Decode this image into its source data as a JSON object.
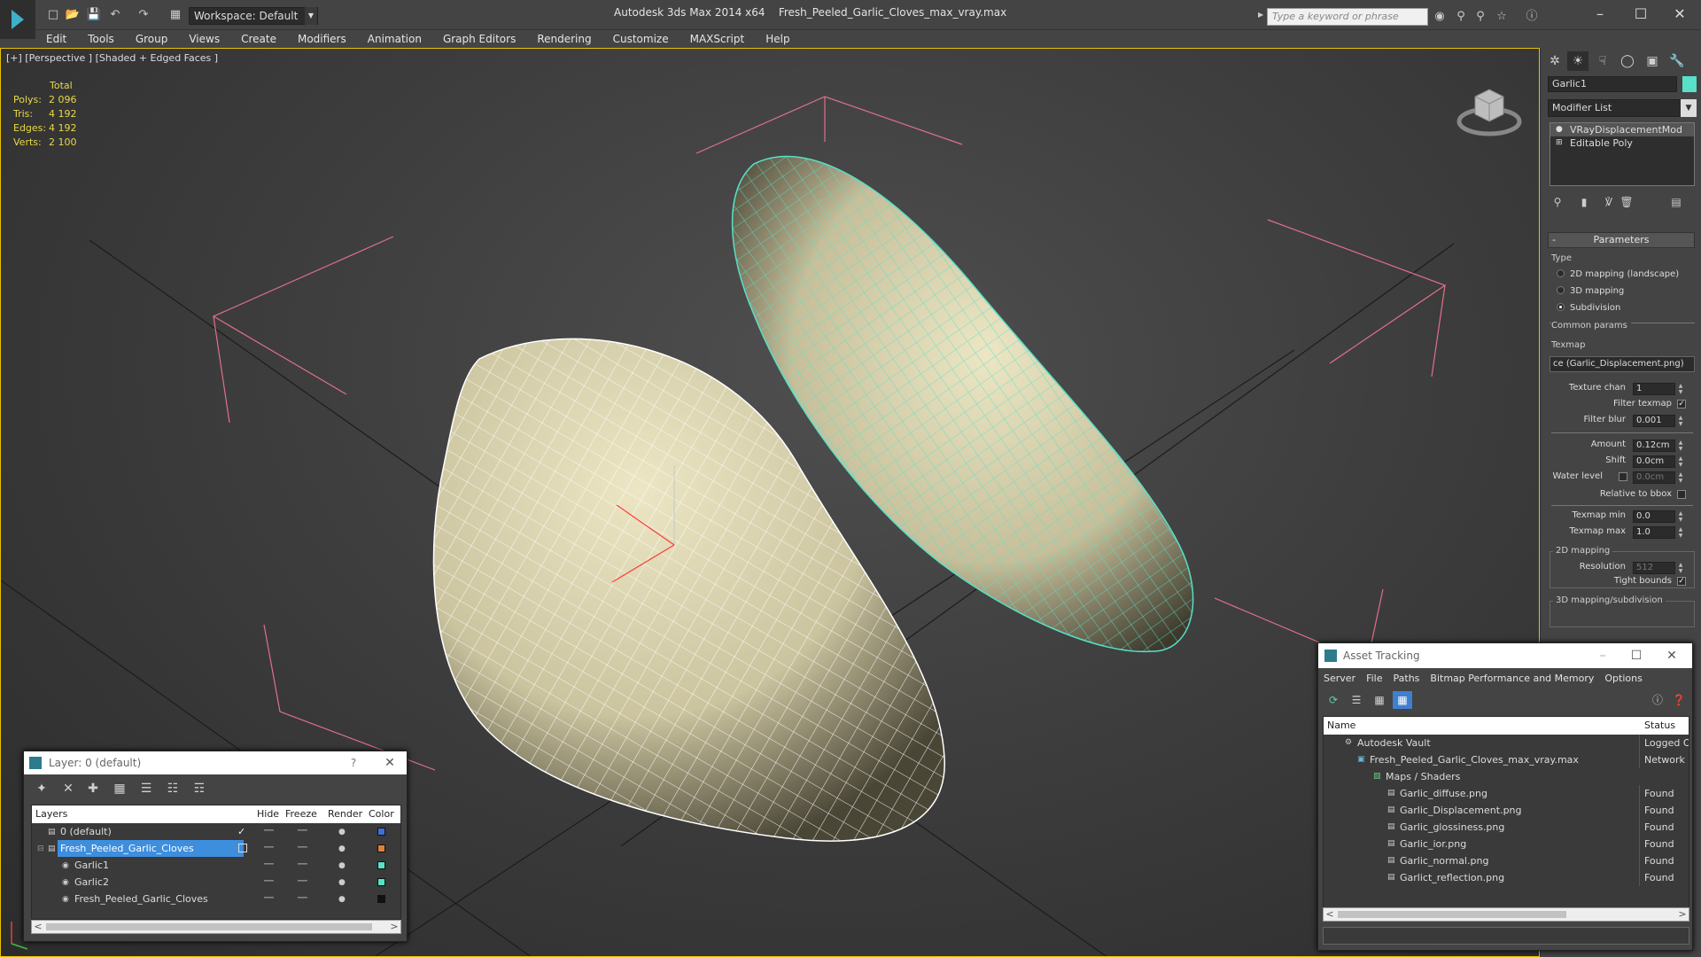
{
  "title": {
    "app": "Autodesk 3ds Max  2014 x64",
    "file": "Fresh_Peeled_Garlic_Cloves_max_vray.max",
    "workspace": "Workspace: Default",
    "search_placeholder": "Type a keyword or phrase",
    "minimize": "–",
    "maximize": "☐",
    "close": "✕"
  },
  "menu": [
    "Edit",
    "Tools",
    "Group",
    "Views",
    "Create",
    "Modifiers",
    "Animation",
    "Graph Editors",
    "Rendering",
    "Customize",
    "MAXScript",
    "Help"
  ],
  "viewport": {
    "label": "[+] [Perspective ] [Shaded + Edged Faces ]",
    "stats": {
      "header": "Total",
      "rows": [
        {
          "label": "Polys:",
          "value": "2 096"
        },
        {
          "label": "Tris:",
          "value": "4 192"
        },
        {
          "label": "Edges:",
          "value": "4 192"
        },
        {
          "label": "Verts:",
          "value": "2 100"
        }
      ]
    },
    "wire_colors": {
      "left": "#ffffff",
      "right": "#58e0c8",
      "mesh": "#d8d2ad",
      "bbox": "#e0708a"
    }
  },
  "command_panel": {
    "object_name": "Garlic1",
    "object_color": "#58e0c8",
    "modifier_list": "Modifier List",
    "stack": [
      {
        "label": "VRayDisplacementMod",
        "icon": "lightbulb-icon"
      },
      {
        "label": "Editable Poly",
        "icon": "plus-box-icon"
      }
    ],
    "rollout": "Parameters",
    "type_label": "Type",
    "types": [
      {
        "label": "2D mapping (landscape)",
        "checked": false
      },
      {
        "label": "3D mapping",
        "checked": false
      },
      {
        "label": "Subdivision",
        "checked": true
      }
    ],
    "common_params": "Common params",
    "texmap_label": "Texmap",
    "texmap_value": "ce (Garlic_Displacement.png)",
    "texture_chan_label": "Texture chan",
    "texture_chan": "1",
    "filter_texmap_label": "Filter texmap",
    "filter_blur_label": "Filter blur",
    "filter_blur": "0.001",
    "amount_label": "Amount",
    "amount": "0.12cm",
    "shift_label": "Shift",
    "shift": "0.0cm",
    "water_level_label": "Water level",
    "water_level": "0.0cm",
    "relative_bbox_label": "Relative to bbox",
    "texmap_min_label": "Texmap min",
    "texmap_min": "0.0",
    "texmap_max_label": "Texmap max",
    "texmap_max": "1.0",
    "mapping2d_label": "2D mapping",
    "resolution_label": "Resolution",
    "resolution": "512",
    "tight_bounds_label": "Tight bounds",
    "mapping3d_label": "3D mapping/subdivision",
    "check_mark": "✓"
  },
  "layer_window": {
    "title": "Layer: 0 (default)",
    "help": "?",
    "close": "✕",
    "columns": [
      "Layers",
      "Hide",
      "Freeze",
      "Render",
      "Color"
    ],
    "rows": [
      {
        "name": "0 (default)",
        "indent": 0,
        "swatch": "#3f6fd8",
        "current": true
      },
      {
        "name": "Fresh_Peeled_Garlic_Cloves",
        "indent": 0,
        "swatch": "#e0803a",
        "selected": true
      },
      {
        "name": "Garlic1",
        "indent": 1,
        "swatch": "#58e0c8"
      },
      {
        "name": "Garlic2",
        "indent": 1,
        "swatch": "#58e0c8"
      },
      {
        "name": "Fresh_Peeled_Garlic_Cloves",
        "indent": 1,
        "swatch": "#111111"
      }
    ],
    "check_mark": "✓",
    "scroll_left": "<",
    "scroll_right": ">"
  },
  "asset_window": {
    "title": "Asset Tracking",
    "menu": [
      "Server",
      "File",
      "Paths",
      "Bitmap Performance and Memory",
      "Options"
    ],
    "columns": [
      "Name",
      "Status"
    ],
    "rows": [
      {
        "name": "Autodesk Vault",
        "indent": 0,
        "status": "Logged Ou"
      },
      {
        "name": "Fresh_Peeled_Garlic_Cloves_max_vray.max",
        "indent": 1,
        "status": "Network P"
      },
      {
        "name": "Maps / Shaders",
        "indent": 2,
        "status": ""
      },
      {
        "name": "Garlic_diffuse.png",
        "indent": 3,
        "status": "Found"
      },
      {
        "name": "Garlic_Displacement.png",
        "indent": 3,
        "status": "Found"
      },
      {
        "name": "Garlic_glossiness.png",
        "indent": 3,
        "status": "Found"
      },
      {
        "name": "Garlic_ior.png",
        "indent": 3,
        "status": "Found"
      },
      {
        "name": "Garlic_normal.png",
        "indent": 3,
        "status": "Found"
      },
      {
        "name": "Garlict_reflection.png",
        "indent": 3,
        "status": "Found"
      }
    ],
    "minimize": "–",
    "maximize": "☐",
    "close": "✕",
    "scroll_left": "<",
    "scroll_right": ">"
  }
}
